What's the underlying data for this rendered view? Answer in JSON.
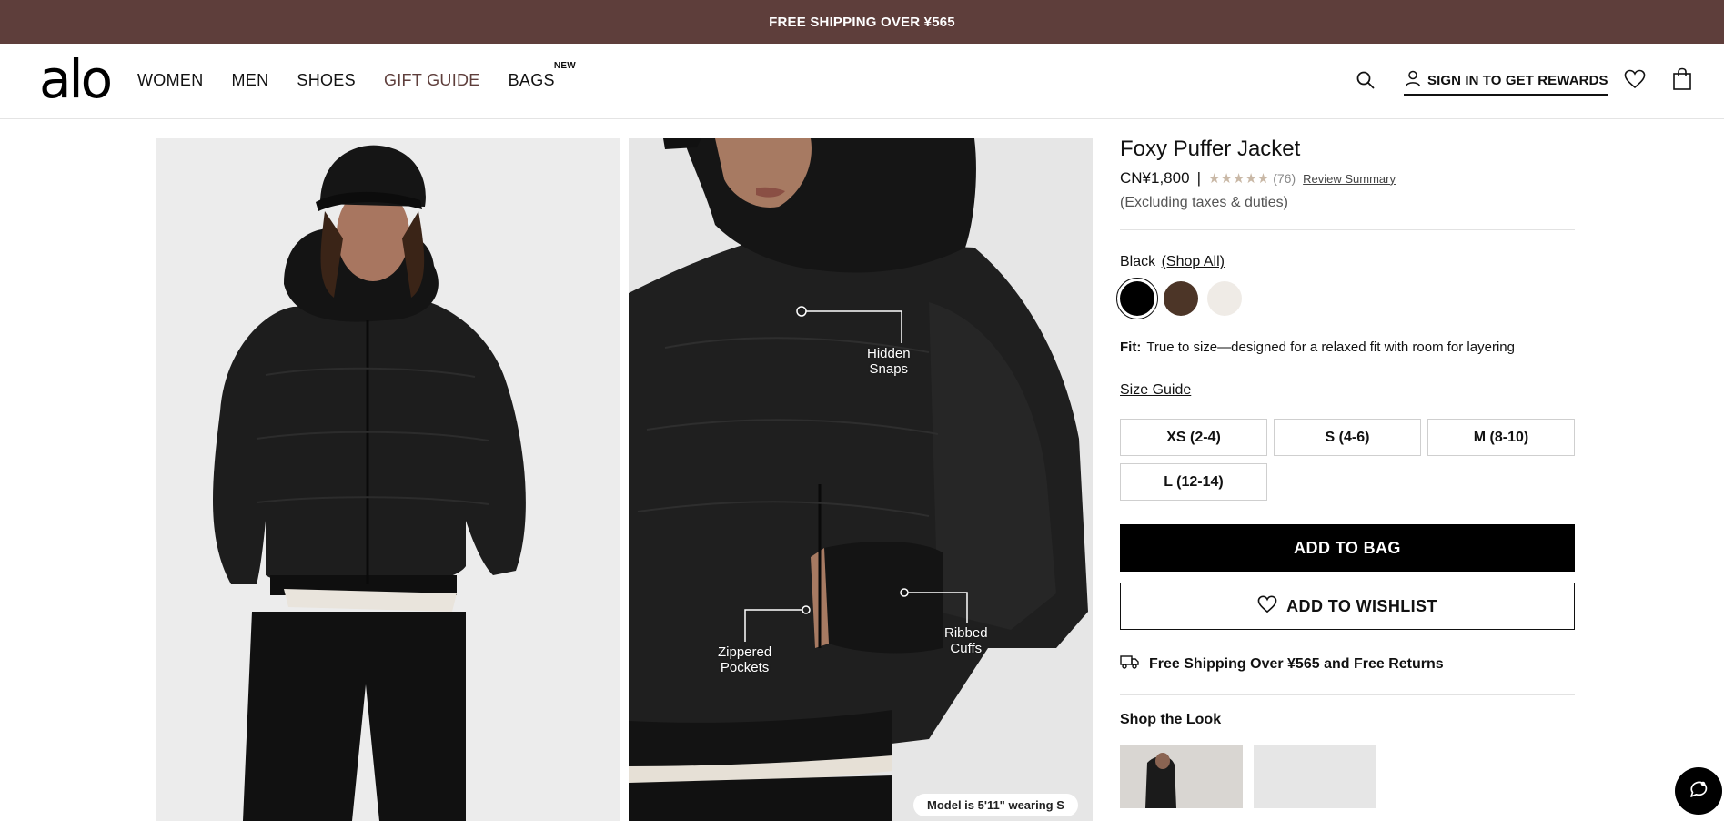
{
  "promo": {
    "text": "FREE SHIPPING OVER ¥565"
  },
  "header": {
    "logo": "alo",
    "nav": [
      {
        "label": "WOMEN"
      },
      {
        "label": "MEN"
      },
      {
        "label": "SHOES"
      },
      {
        "label": "GIFT GUIDE"
      },
      {
        "label": "BAGS",
        "badge": "NEW"
      }
    ],
    "signin_label": "SIGN IN TO GET REWARDS",
    "icons": [
      "search-icon",
      "user-icon",
      "heart-icon",
      "bag-icon"
    ]
  },
  "gallery": {
    "model_note": "Model is 5'11\" wearing S",
    "callouts": {
      "snaps": "Hidden\nSnaps",
      "pockets": "Zippered\nPockets",
      "cuffs": "Ribbed\nCuffs"
    }
  },
  "product": {
    "title": "Foxy Puffer Jacket",
    "price": "CN¥1,800",
    "separator": "|",
    "stars": "★★★★★",
    "rating": 5,
    "review_count": "(76)",
    "review_summary": "Review Summary",
    "tax_note": "(Excluding taxes & duties)",
    "color_name": "Black",
    "shop_all": "(Shop All)",
    "swatches": [
      {
        "name": "black",
        "color": "#000000",
        "selected": true
      },
      {
        "name": "espresso",
        "color": "#4c3527",
        "selected": false
      },
      {
        "name": "ivory",
        "color": "#efebe6",
        "selected": false
      }
    ],
    "fit_label": "Fit:",
    "fit_text": "True to size—designed for a relaxed fit with room for layering",
    "size_guide": "Size Guide",
    "sizes": [
      "XS (2-4)",
      "S (4-6)",
      "M (8-10)",
      "L (12-14)"
    ],
    "add_to_bag": "ADD TO BAG",
    "add_to_wishlist": "ADD TO WISHLIST",
    "shipping_text": "Free Shipping Over ¥565 and Free Returns",
    "shop_the_look": "Shop the Look"
  },
  "colors": {
    "promo_bg": "#5e3e3b",
    "gift_guide": "#5e3e3b",
    "primary_button": "#000000"
  }
}
